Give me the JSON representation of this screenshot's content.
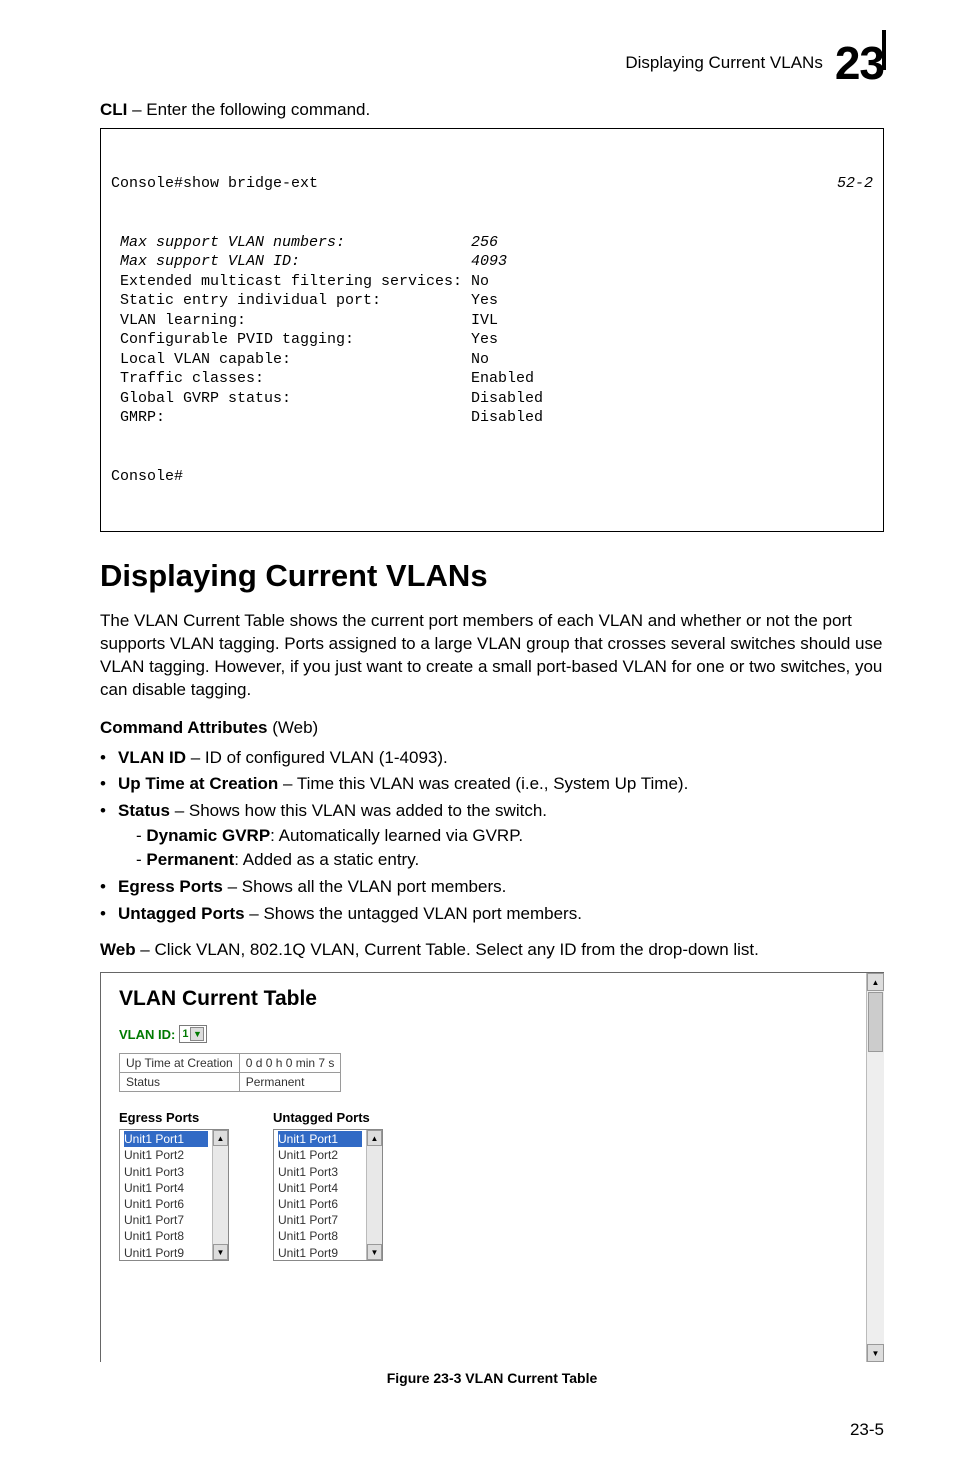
{
  "header": {
    "title": "Displaying Current VLANs",
    "chapter_big": "23"
  },
  "intro_cli": {
    "bold": "CLI",
    "rest": " – Enter the following command."
  },
  "cli": {
    "line1_cmd": "Console#show bridge-ext",
    "line1_page": "52-2",
    "rows": [
      {
        "label": " Max support VLAN numbers:",
        "value": "256",
        "italic": true
      },
      {
        "label": " Max support VLAN ID:",
        "value": "4093",
        "italic": true
      },
      {
        "label": " Extended multicast filtering services:",
        "value": "No"
      },
      {
        "label": " Static entry individual port:",
        "value": "Yes"
      },
      {
        "label": " VLAN learning:",
        "value": "IVL"
      },
      {
        "label": " Configurable PVID tagging:",
        "value": "Yes"
      },
      {
        "label": " Local VLAN capable:",
        "value": "No"
      },
      {
        "label": " Traffic classes:",
        "value": "Enabled"
      },
      {
        "label": " Global GVRP status:",
        "value": "Disabled"
      },
      {
        "label": " GMRP:",
        "value": "Disabled"
      }
    ],
    "last": "Console#"
  },
  "section_heading": "Displaying Current VLANs",
  "body_para": "The VLAN Current Table shows the current port members of each VLAN and whether or not the port supports VLAN tagging. Ports assigned to a large VLAN group that crosses several switches should use VLAN tagging. However, if you just want to create a small port-based VLAN for one or two switches, you can disable tagging.",
  "cmd_attr_label": {
    "bold": "Command Attributes",
    "rest": " (Web)"
  },
  "bullets": {
    "b1": {
      "bold": "VLAN ID",
      "rest": " – ID of configured VLAN (1-4093)."
    },
    "b2": {
      "bold": "Up Time at Creation",
      "rest": " – Time this VLAN was created (i.e., System Up Time)."
    },
    "b3": {
      "bold": "Status",
      "rest": " – Shows how this VLAN was added to the switch."
    },
    "b3a": {
      "pre": "- ",
      "bold": "Dynamic GVRP",
      "rest": ": Automatically learned via GVRP."
    },
    "b3b": {
      "pre": "- ",
      "bold": "Permanent",
      "rest": ": Added as a static entry."
    },
    "b4": {
      "bold": "Egress Ports",
      "rest": " – Shows all the VLAN port members."
    },
    "b5": {
      "bold": "Untagged Ports",
      "rest": " – Shows the untagged VLAN port members."
    }
  },
  "web_line": {
    "bold": "Web",
    "rest": " – Click VLAN, 802.1Q VLAN, Current Table. Select any ID from the drop-down list."
  },
  "screenshot": {
    "title": "VLAN Current Table",
    "vlan_id_label": "VLAN ID:",
    "vlan_id_value": "1",
    "meta": {
      "uptime_label": "Up Time at Creation",
      "uptime_value": "0 d 0 h 0 min 7 s",
      "status_label": "Status",
      "status_value": "Permanent"
    },
    "egress_head": "Egress Ports",
    "untagged_head": "Untagged Ports",
    "egress_items": [
      "Unit1 Port1",
      "Unit1 Port2",
      "Unit1 Port3",
      "Unit1 Port4",
      "Unit1 Port6",
      "Unit1 Port7",
      "Unit1 Port8",
      "Unit1 Port9"
    ],
    "untagged_items": [
      "Unit1 Port1",
      "Unit1 Port2",
      "Unit1 Port3",
      "Unit1 Port4",
      "Unit1 Port6",
      "Unit1 Port7",
      "Unit1 Port8",
      "Unit1 Port9"
    ]
  },
  "figure_caption": "Figure 23-3  VLAN Current Table",
  "footer_page": "23-5"
}
